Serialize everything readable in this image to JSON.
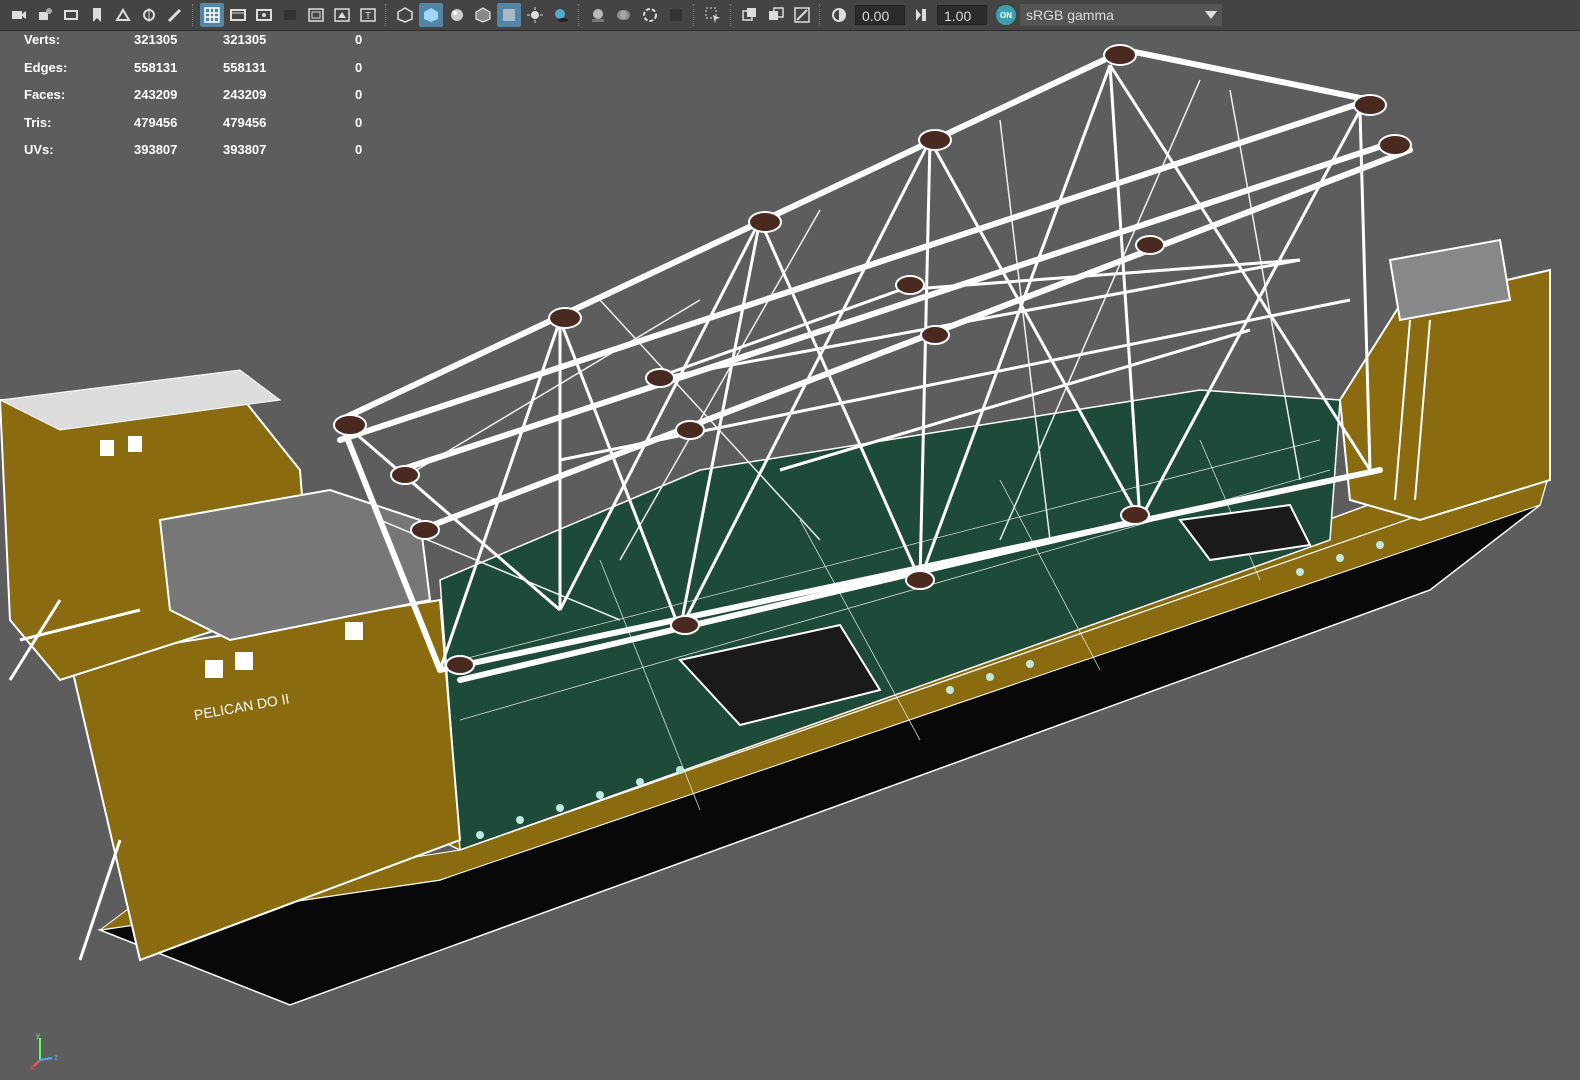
{
  "toolbar": {
    "exposure_value": "0.00",
    "gamma_value": "1.00",
    "color_management_badge": "ON",
    "color_space": "sRGB gamma",
    "icons": [
      "camera-icon",
      "camera-attributes-icon",
      "bookmark-icon",
      "image-plane-icon",
      "2d-pan-zoom-icon",
      "grease-pencil-icon",
      "grid-icon",
      "film-gate-icon",
      "resolution-gate-icon",
      "gate-mask-icon",
      "field-chart-icon",
      "safe-action-icon",
      "safe-title-icon",
      "wireframe-icon",
      "smooth-shade-icon",
      "default-material-icon",
      "wireframe-on-shaded-icon",
      "xray-icon",
      "lighting-icon",
      "shadows-icon",
      "ambient-occlusion-icon",
      "motion-blur-icon",
      "anti-aliasing-icon",
      "depth-of-field-icon",
      "isolate-select-icon",
      "xray-joints-icon",
      "xray-active-icon",
      "backface-icon"
    ]
  },
  "hud": {
    "rows": [
      {
        "label": "Verts:",
        "v1": "321305",
        "v2": "321305",
        "v3": "0"
      },
      {
        "label": "Edges:",
        "v1": "558131",
        "v2": "558131",
        "v3": "0"
      },
      {
        "label": "Faces:",
        "v1": "243209",
        "v2": "243209",
        "v3": "0"
      },
      {
        "label": "Tris:",
        "v1": "479456",
        "v2": "479456",
        "v3": "0"
      },
      {
        "label": "UVs:",
        "v1": "393807",
        "v2": "393807",
        "v3": "0"
      }
    ]
  },
  "viewport": {
    "hull_marking": "PELICAN DO II",
    "colors": {
      "background": "#5d5d5d",
      "hull_side": "#8a6b10",
      "deck": "#1e4a3a",
      "hull_bottom": "#080808",
      "wire": "#ffffff"
    }
  },
  "axis": {
    "x": "x",
    "y": "y",
    "z": "z"
  }
}
